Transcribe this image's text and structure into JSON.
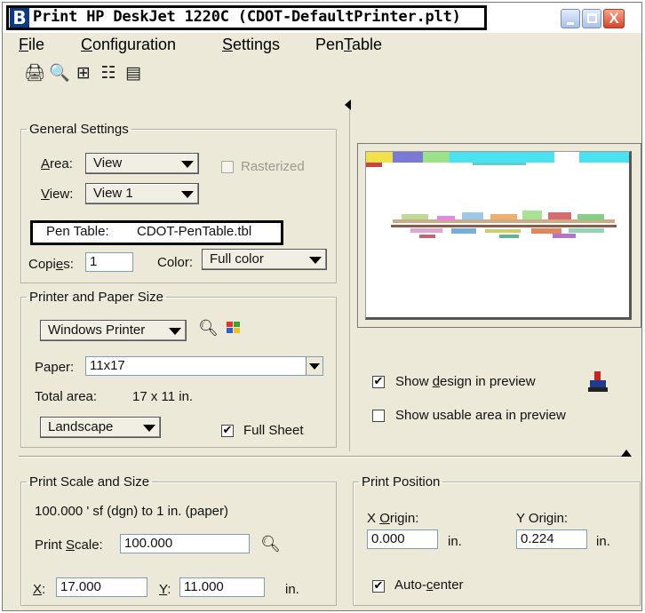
{
  "window": {
    "title": "Print  HP DeskJet 1220C  (CDOT-DefaultPrinter.plt)",
    "app_icon_letter": "B",
    "close_symbol": "X"
  },
  "menu": {
    "file": {
      "mnemonic": "F",
      "rest": "ile"
    },
    "configuration": {
      "mnemonic": "C",
      "rest": "onfiguration"
    },
    "settings": {
      "mnemonic": "S",
      "rest": "ettings"
    },
    "pentable": {
      "pre": "Pen",
      "mnemonic": "T",
      "rest": "able"
    }
  },
  "toolbar": {
    "icons": [
      "printer-icon",
      "preview-icon",
      "fit-icon",
      "list-icon",
      "properties-icon"
    ],
    "glyphs": [
      "🖨",
      "🔍",
      "⊞",
      "☷",
      "▤"
    ]
  },
  "general": {
    "legend": "General Settings",
    "area_label": {
      "mnemonic": "A",
      "rest": "rea:"
    },
    "area_value": "View",
    "rasterized_label": "Rasterized",
    "view_label": {
      "mnemonic": "V",
      "rest": "iew:"
    },
    "view_value": "View 1",
    "pen_table_label": "Pen Table:",
    "pen_table_value": "CDOT-PenTable.tbl",
    "copies_label": {
      "pre": "Copi",
      "mnemonic": "e",
      "rest": "s:"
    },
    "copies_value": "1",
    "color_label": "Color:",
    "color_value": "Full color"
  },
  "printer": {
    "legend": "Printer and Paper Size",
    "driver_value": "Windows Printer",
    "paper_label": "Paper:",
    "paper_value": "11x17",
    "total_area_label": "Total area:",
    "total_area_value": "17 x 11 in.",
    "orientation_value": "Landscape",
    "full_sheet_label": "Full Sheet",
    "full_sheet_checked": true
  },
  "preview": {
    "show_design": {
      "pre": "Show ",
      "mnemonic": "d",
      "rest": "esign in preview"
    },
    "show_design_checked": true,
    "show_usable": "Show usable area in preview",
    "show_usable_checked": false
  },
  "scale": {
    "legend": "Print Scale and Size",
    "ratio_text": "100.000 ' sf (dgn) to 1 in. (paper)",
    "scale_label": {
      "pre": "Print ",
      "mnemonic": "S",
      "rest": "cale:"
    },
    "scale_value": "100.000",
    "x_label": {
      "mnemonic": "X",
      "rest": ":"
    },
    "x_value": "17.000",
    "y_label": {
      "mnemonic": "Y",
      "rest": ":"
    },
    "y_value": "11.000",
    "units": "in."
  },
  "position": {
    "legend": "Print Position",
    "x_origin_label": {
      "pre": "X ",
      "mnemonic": "O",
      "rest": "rigin:"
    },
    "x_origin_value": "0.000",
    "y_origin_label": "Y Origin:",
    "y_origin_value": "0.224",
    "units": "in.",
    "auto_center_label": {
      "pre": "Auto-",
      "mnemonic": "c",
      "rest": "enter"
    },
    "auto_center_checked": true
  },
  "check_mark": "✔"
}
